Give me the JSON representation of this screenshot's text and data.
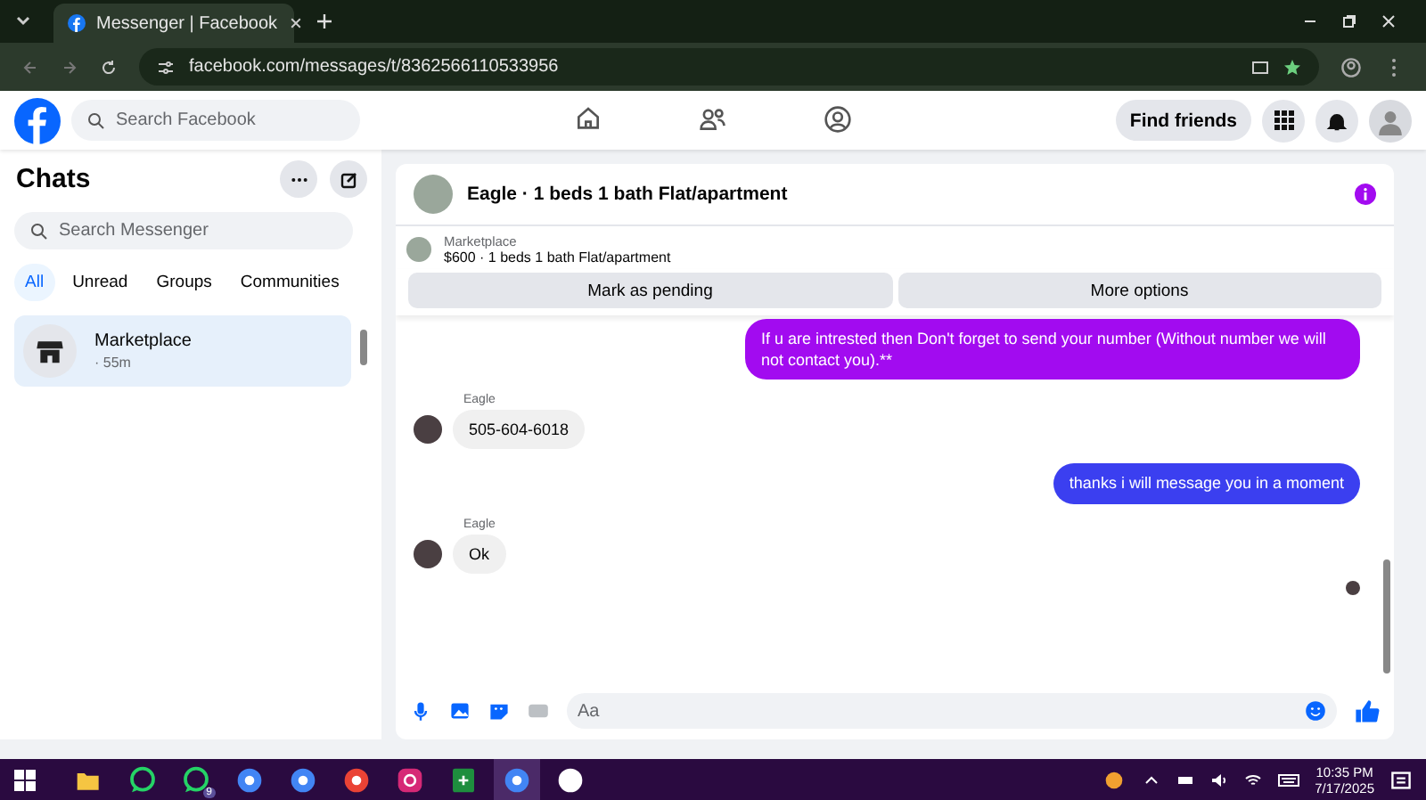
{
  "browser": {
    "tab_title": "Messenger | Facebook",
    "url": "facebook.com/messages/t/8362566110533956"
  },
  "header": {
    "search": {
      "placeholder": "Search Facebook"
    },
    "nav": [
      {
        "kind": "home",
        "selected": false
      },
      {
        "kind": "friends",
        "selected": false
      },
      {
        "kind": "profile",
        "selected": false
      }
    ],
    "find_friends": "Find friends"
  },
  "sidebar": {
    "title": "Chats",
    "search": {
      "placeholder": "Search Messenger"
    },
    "filters": [
      {
        "label": "All",
        "selected": true
      },
      {
        "label": "Unread",
        "selected": false
      },
      {
        "label": "Groups",
        "selected": false
      },
      {
        "label": "Communities",
        "selected": false
      }
    ],
    "chats": [
      {
        "name": "Marketplace",
        "time": "· 55m",
        "selected": true
      }
    ]
  },
  "conversation": {
    "title": "Eagle · 1 beds 1 bath Flat/apartment",
    "listing": {
      "source": "Marketplace",
      "summary": "$600 · 1 beds 1 bath Flat/apartment"
    },
    "actions": [
      "Mark as pending",
      "More options"
    ],
    "messages": [
      {
        "kind": "sent",
        "text": "If u are intrested then  Don't forget to send your number (Without number we will not contact you).**",
        "color": "#a20bf0"
      },
      {
        "kind": "received",
        "sender": "Eagle",
        "text": "505-604-6018"
      },
      {
        "kind": "sent",
        "text": "thanks i will message you in a moment",
        "color": "#3b3ff0"
      },
      {
        "kind": "received",
        "sender": "Eagle",
        "text": "Ok"
      }
    ],
    "composer": {
      "placeholder": "Aa"
    }
  },
  "taskbar": {
    "apps": [
      {
        "kind": "folder",
        "color": "#f5c542",
        "selected": false
      },
      {
        "kind": "chat",
        "color": "#25d366",
        "selected": false
      },
      {
        "kind": "chat",
        "color": "#25d366",
        "badge": "9",
        "selected": false
      },
      {
        "kind": "browser",
        "color": "#4285f4",
        "selected": false
      },
      {
        "kind": "browser",
        "color": "#4285f4",
        "selected": false
      },
      {
        "kind": "browser",
        "color": "#ea4335",
        "selected": false
      },
      {
        "kind": "camera",
        "color": "#d62976",
        "selected": false
      },
      {
        "kind": "sheet",
        "color": "#1e8e3e",
        "selected": false
      },
      {
        "kind": "browser",
        "color": "#4285f4",
        "selected": true
      },
      {
        "kind": "browser",
        "color": "#ffffff",
        "selected": false
      }
    ],
    "time": "10:35 PM",
    "date": "7/17/2025"
  }
}
